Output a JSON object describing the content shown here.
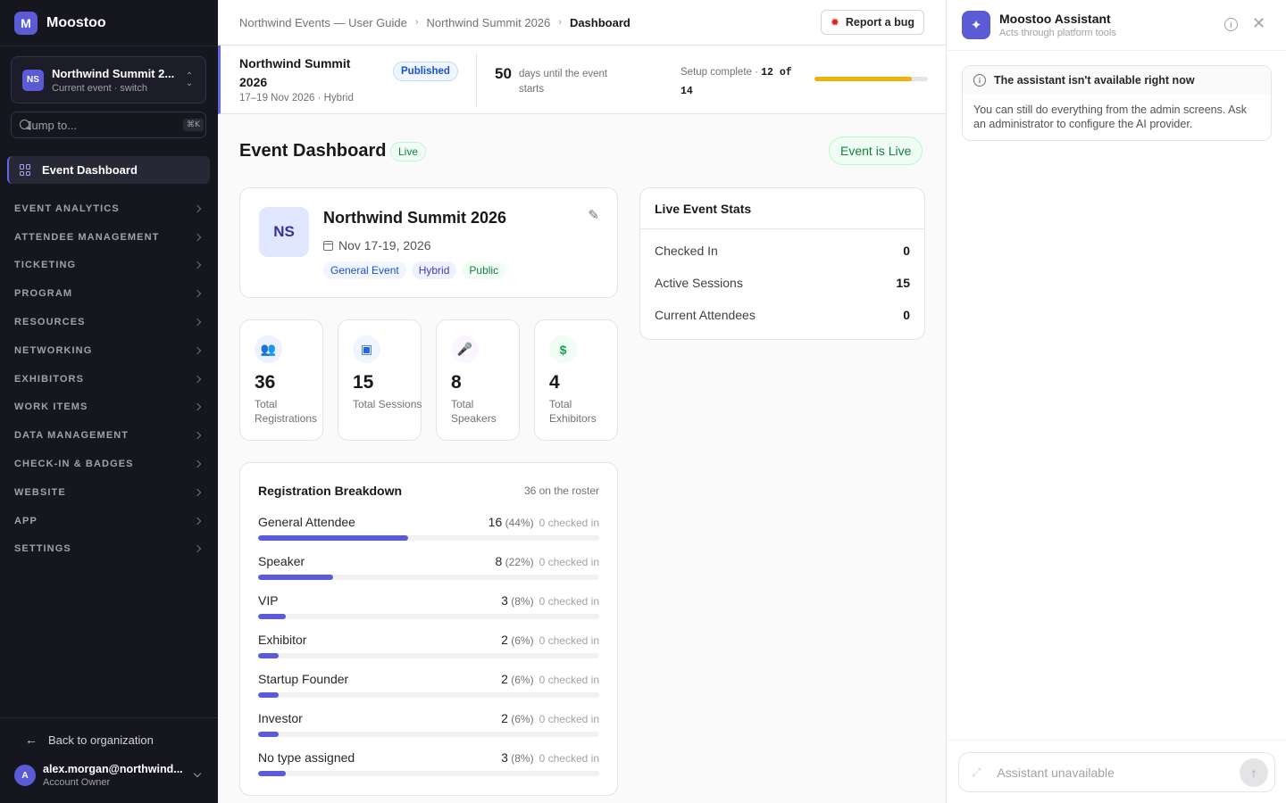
{
  "brand": {
    "logo_letter": "M",
    "name": "Moostoo"
  },
  "event_switcher": {
    "avatar": "NS",
    "title": "Northwind Summit 2...",
    "subtitle": "Current event · switch"
  },
  "jump": {
    "placeholder": "Jump to...",
    "shortcut": "⌘K"
  },
  "nav": {
    "active": {
      "label": "Event Dashboard",
      "icon": "grid-icon"
    },
    "groups": [
      {
        "label": "EVENT ANALYTICS"
      },
      {
        "label": "ATTENDEE MANAGEMENT"
      },
      {
        "label": "TICKETING"
      },
      {
        "label": "PROGRAM"
      },
      {
        "label": "RESOURCES"
      },
      {
        "label": "NETWORKING"
      },
      {
        "label": "EXHIBITORS"
      },
      {
        "label": "WORK ITEMS"
      },
      {
        "label": "DATA MANAGEMENT"
      },
      {
        "label": "CHECK-IN & BADGES"
      },
      {
        "label": "WEBSITE"
      },
      {
        "label": "APP"
      },
      {
        "label": "SETTINGS"
      }
    ]
  },
  "footer": {
    "back_label": "Back to organization",
    "user_initial": "A",
    "user_email": "alex.morgan@northwind...",
    "user_role": "Account Owner"
  },
  "breadcrumbs": [
    "Northwind Events — User Guide",
    "Northwind Summit 2026",
    "Dashboard"
  ],
  "report_bug": {
    "label": "Report a bug",
    "icon": "bug-icon"
  },
  "event_bar": {
    "title": "Northwind Summit 2026",
    "subtitle": "17–19 Nov 2026 · Hybrid",
    "status": "Published",
    "days": "50",
    "days_text": "days until the event starts",
    "setup_label": "Setup complete ·",
    "setup_count": "12 of 14",
    "setup_done": 12,
    "setup_total": 14,
    "setup_color": "#eab308"
  },
  "dashboard": {
    "title": "Event Dashboard",
    "badge": "Live",
    "live_button": "Event is Live"
  },
  "event_card": {
    "avatar": "NS",
    "title": "Northwind Summit 2026",
    "date": "Nov 17-19, 2026",
    "tags": [
      "General Event",
      "Hybrid",
      "Public"
    ]
  },
  "stats": [
    {
      "icon": "users-icon",
      "glyph": "👥",
      "value": "36",
      "label": "Total Registrations",
      "color": "#4f46e5",
      "bg": "#eef2ff"
    },
    {
      "icon": "calendar-icon",
      "glyph": "▣",
      "value": "15",
      "label": "Total Sessions",
      "color": "#2563eb",
      "bg": "#eff6ff"
    },
    {
      "icon": "mic-icon",
      "glyph": "🎤",
      "value": "8",
      "label": "Total Speakers",
      "color": "#9333ea",
      "bg": "#faf5ff"
    },
    {
      "icon": "dollar-icon",
      "glyph": "$",
      "value": "4",
      "label": "Total Exhibitors",
      "color": "#16a34a",
      "bg": "#f0fdf4"
    }
  ],
  "breakdown": {
    "title": "Registration Breakdown",
    "roster": "36 on the roster",
    "rows": [
      {
        "name": "General Attendee",
        "count": "16",
        "pct": "(44%)",
        "pct_value": 44,
        "checked": "0 checked in"
      },
      {
        "name": "Speaker",
        "count": "8",
        "pct": "(22%)",
        "pct_value": 22,
        "checked": "0 checked in"
      },
      {
        "name": "VIP",
        "count": "3",
        "pct": "(8%)",
        "pct_value": 8,
        "checked": "0 checked in"
      },
      {
        "name": "Exhibitor",
        "count": "2",
        "pct": "(6%)",
        "pct_value": 6,
        "checked": "0 checked in"
      },
      {
        "name": "Startup Founder",
        "count": "2",
        "pct": "(6%)",
        "pct_value": 6,
        "checked": "0 checked in"
      },
      {
        "name": "Investor",
        "count": "2",
        "pct": "(6%)",
        "pct_value": 6,
        "checked": "0 checked in"
      },
      {
        "name": "No type assigned",
        "count": "3",
        "pct": "(8%)",
        "pct_value": 8,
        "checked": "0 checked in"
      }
    ]
  },
  "live_stats": {
    "title": "Live Event Stats",
    "rows": [
      {
        "label": "Checked In",
        "value": "0"
      },
      {
        "label": "Active Sessions",
        "value": "15"
      },
      {
        "label": "Current Attendees",
        "value": "0"
      }
    ]
  },
  "assistant": {
    "title": "Moostoo Assistant",
    "subtitle": "Acts through platform tools",
    "notice_title": "The assistant isn't available right now",
    "notice_body": "You can still do everything from the admin screens. Ask an administrator to configure the AI provider.",
    "input_placeholder": "Assistant unavailable"
  }
}
